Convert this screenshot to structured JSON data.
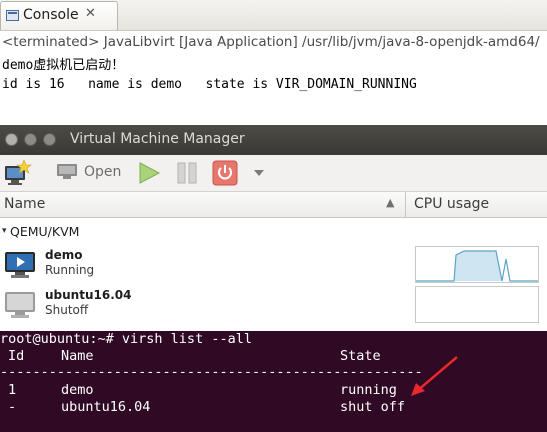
{
  "console": {
    "tab_label": "Console",
    "tab_close": "✕",
    "status_line": "<terminated> JavaLibvirt [Java Application] /usr/lib/jvm/java-8-openjdk-amd64/",
    "output": [
      "demo虚拟机已启动！",
      "id is 16   name is demo   state is VIR_DOMAIN_RUNNING"
    ]
  },
  "vmm": {
    "window_title": "Virtual Machine Manager",
    "toolbar": {
      "new_icon": "new-vm-icon",
      "open_label": "Open",
      "run_icon": "play-icon",
      "pause_icon": "pause-icon",
      "shutdown_icon": "power-icon",
      "dropdown_icon": "chevron-down-icon"
    },
    "columns": {
      "name": "Name",
      "sort_indicator": "▲",
      "cpu": "CPU usage"
    },
    "group": {
      "label": "QEMU/KVM",
      "arrow": "▾"
    },
    "vms": [
      {
        "name": "demo",
        "state": "Running",
        "icon": "monitor-running-icon"
      },
      {
        "name": "ubuntu16.04",
        "state": "Shutoff",
        "icon": "monitor-off-icon"
      }
    ]
  },
  "terminal": {
    "prompt_command": "root@ubuntu:~# virsh list --all",
    "headers": {
      "id": "Id",
      "name": "Name",
      "state": "State"
    },
    "separator": "----------------------------------------------------",
    "rows": [
      {
        "id": "1",
        "name": "demo",
        "state": "running"
      },
      {
        "id": "-",
        "name": "ubuntu16.04",
        "state": "shut off"
      }
    ],
    "annotation_color": "#e8282a"
  },
  "colors": {
    "terminal_bg": "#300a24",
    "titlebar_bg": "#3c3b37",
    "cpu_graph_fill": "#cfe5f2",
    "cpu_graph_line": "#5ba3c9",
    "run_button": "#8bc34a",
    "shutdown_button": "#e05a50"
  }
}
